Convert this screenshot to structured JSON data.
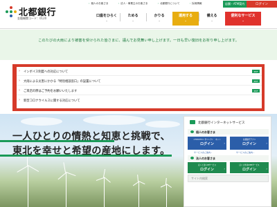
{
  "header": {
    "logo_text": "北都銀行",
    "logo_sub": "金融機関コード：0120",
    "util_links": [
      "個人のお客さま",
      "法人・事業主のお客さま",
      "北都銀行について",
      "採用情報"
    ],
    "atm_button": "店舗・ATM案内",
    "login_button": "ログイン",
    "nav": [
      {
        "label": "口座をひらく"
      },
      {
        "label": "ためる"
      },
      {
        "label": "かりる"
      },
      {
        "label": "運用する"
      },
      {
        "label": "備える"
      },
      {
        "label": "便利なサービス"
      }
    ]
  },
  "notice": {
    "message": "このたびの大雨により被害を受けられた皆さまに、謹んでお見舞い申し上げます。一日も早い復旧をお祈り申し上げます。"
  },
  "info": {
    "items": [
      {
        "text": "インボイス制度への対応について",
        "badge": "PDF"
      },
      {
        "text": "大雨による災害にかかる「特別相談窓口」の設置について",
        "badge": "PDF"
      },
      {
        "text": "ご来店の際はご予約をお願いいたします",
        "badge": "PDF"
      },
      {
        "text": "新型コロナウイルスに関する対応について",
        "badge": ""
      }
    ]
  },
  "hero": {
    "line1": "一人ひとりの情熱と知恵と挑戦で、",
    "line2": "東北を幸せと希望の産地にします。"
  },
  "services": {
    "title": "北都銀行インターネットサービス",
    "personal_heading": "個人のお客さま",
    "personal_buttons": [
      {
        "sub": "<HOKUTO> ダイレクト　ネット",
        "main": "ログイン"
      },
      {
        "sub": "北都銀行アプリ",
        "main": "ログイン"
      }
    ],
    "personal_links": [
      "サービスのご案内",
      "サービスのご案内"
    ],
    "corporate_heading": "法人のお客さま",
    "corporate_buttons": [
      {
        "sub": "ほくと法人IBサービス",
        "main": "ログイン"
      },
      {
        "sub": "ほくと外為WEBサービス",
        "main": "ログイン"
      }
    ],
    "corporate_links": [
      "サービスのご案内",
      "サービスのご案内"
    ],
    "search_placeholder": "サイト内検索"
  },
  "colors": {
    "brand_green": "#1a9a58",
    "brand_red": "#d63a2a",
    "nav_yellow": "#e8ad10",
    "login_blue": "#2b5ea9"
  },
  "icons": {
    "logo": "hokuto-logo-icon",
    "chevron": "chevron-down-icon",
    "arrow": "arrow-right-icon"
  }
}
